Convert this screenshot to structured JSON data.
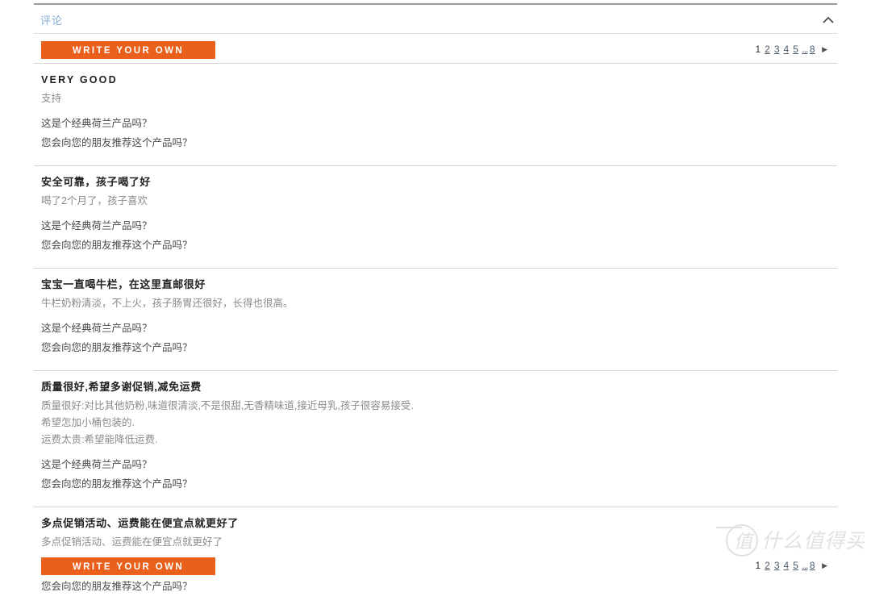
{
  "section": {
    "title": "评论",
    "collapse_icon": "chevron-up-icon"
  },
  "toolbar": {
    "write_review_label": "WRITE YOUR OWN"
  },
  "pagination_top": {
    "pages": [
      "1",
      "2",
      "3",
      "4",
      "5",
      "...",
      "8"
    ],
    "current": "1",
    "next_label": "▶"
  },
  "pagination_bottom": {
    "pages": [
      "1",
      "2",
      "3",
      "4",
      "5",
      "...",
      "8"
    ],
    "current": "1",
    "next_label": "▶"
  },
  "questions": {
    "q1": "这是个经典荷兰产品吗？",
    "q2": "您会向您的朋友推荐这个产品吗？"
  },
  "reviews": [
    {
      "title": "VERY GOOD",
      "title_style": "latin",
      "body": [
        "支持"
      ]
    },
    {
      "title": "安全可靠，孩子喝了好",
      "title_style": "cjk",
      "body": [
        "喝了2个月了，孩子喜欢"
      ]
    },
    {
      "title": "宝宝一直喝牛栏，在这里直邮很好",
      "title_style": "cjk",
      "body": [
        "牛栏奶粉清淡，不上火，孩子肠胃还很好，长得也很高。"
      ]
    },
    {
      "title": "质量很好,希望多谢促销,减免运费",
      "title_style": "cjk",
      "body": [
        "质量很好:对比其他奶粉,味道很清淡,不是很甜,无香精味道,接近母乳,孩子很容易接受.",
        "希望怎加小桶包装的.",
        "运费太贵:希望能降低运费."
      ]
    },
    {
      "title": "多点促销活动、运费能在便宜点就更好了",
      "title_style": "cjk",
      "body": [
        "多点促销活动、运费能在便宜点就更好了"
      ]
    }
  ],
  "watermark": {
    "text": "什么值得买",
    "mark": "值"
  },
  "colors": {
    "accent_orange": "#e8601c",
    "header_blue": "#7fadd9",
    "body_gray": "#8b8b8b",
    "rule_gray": "#d6d6d6"
  }
}
